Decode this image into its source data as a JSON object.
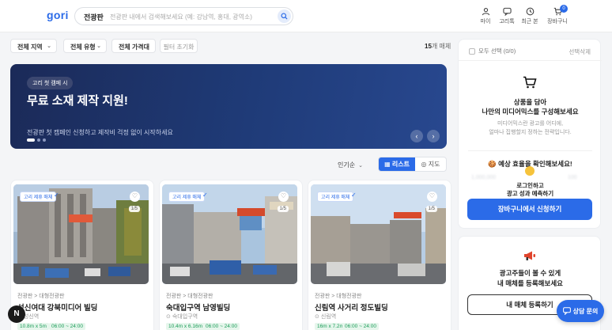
{
  "header": {
    "logo": "gori",
    "search": {
      "region": "전광판",
      "placeholder": "전광판 내에서 검색해보세요 (예: 강남역, 홍대, 광역소)"
    },
    "icons": [
      {
        "label": "마이",
        "icon": "user-icon"
      },
      {
        "label": "고리톡",
        "icon": "chat-icon"
      },
      {
        "label": "최근 본",
        "icon": "clock-icon"
      },
      {
        "label": "장바구니",
        "icon": "cart-icon",
        "badge": "0"
      }
    ]
  },
  "filters": {
    "region": "전체 지역",
    "type": "전체 유형",
    "price": "전체 가격대",
    "reset": "필터 초기화",
    "count_num": "15",
    "count_unit": "개 매체"
  },
  "banner": {
    "pill": "고리 첫 캠페 시",
    "title": "무료 소재 제작 지원!",
    "subtitle": "전광판 첫 캠페인 신청하고 제작비 걱정 없이 시작하세요",
    "prev": "‹",
    "next": "›"
  },
  "sort": {
    "label": "인기순",
    "list": "리스트",
    "map": "지도"
  },
  "cards": [
    {
      "tag": "고리 제휴 매체",
      "pages": "1/5",
      "category": "전광판 > 대형전광판",
      "name": "성신여대 강북미디어 빌딩",
      "location": "성신역",
      "size": "10.8m x 5m",
      "time": "06:00 ~ 24:00"
    },
    {
      "tag": "고리 제휴 매체",
      "pages": "1/5",
      "category": "전광판 > 대형전광판",
      "name": "숙대입구역 남영빌딩",
      "location": "숙대입구역",
      "size": "10.4m x 6.16m",
      "time": "06:00 ~ 24:00"
    },
    {
      "tag": "고리 제휴 매체",
      "pages": "1/5",
      "category": "전광판 > 대형전광판",
      "name": "신림역 사거리 정도빌딩",
      "location": "신림역",
      "size": "16m x 7.2m",
      "time": "06:00 ~ 24:00"
    }
  ],
  "cart_panel": {
    "select_all": "모두 선택 (0/0)",
    "delete_selected": "선택삭제",
    "empty_title_1": "상품을 담아",
    "empty_title_2": "나만의 미디어믹스를 구성해보세요",
    "empty_desc_1": "미디어믹스란 광고를 어디에,",
    "empty_desc_2": "얼마나 집행할지 정하는 전략입니다.",
    "effect_title": "🍪 예상 효율을 확인해보세요!",
    "blur_1": "1,000,000",
    "blur_2": "100",
    "login_1": "로그인하고",
    "login_2": "광고 성과 예측하기",
    "cta": "장바구니에서 신청하기"
  },
  "register_panel": {
    "title_1": "광고주들이 볼 수 있게",
    "title_2": "내 매체를 등록해보세요",
    "button": "내 매체 등록하기"
  },
  "chat_button": "상담 문의",
  "floating_badge": "N",
  "colors": {
    "accent": "#2b6be8",
    "banner": "#1f3b78",
    "green": "#1a9c58"
  }
}
